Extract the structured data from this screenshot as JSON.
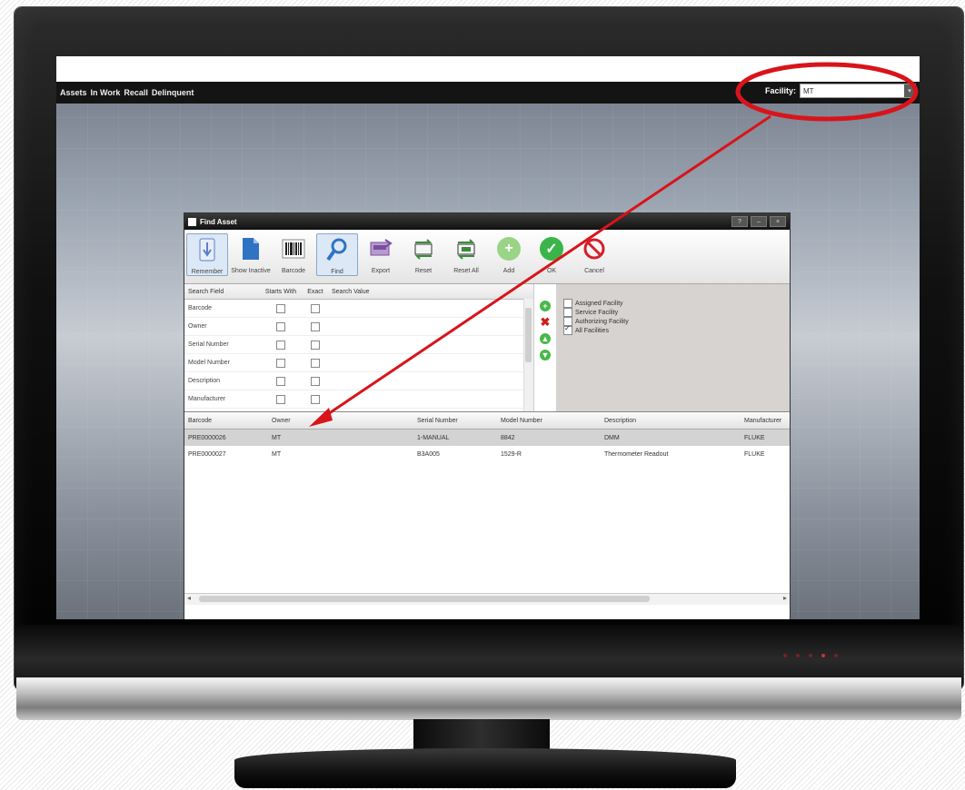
{
  "menubar": {
    "items": [
      "Assets",
      "In Work",
      "Recall",
      "Delinquent"
    ]
  },
  "facility": {
    "label": "Facility:",
    "value": "MT"
  },
  "dialog": {
    "title": "Find Asset",
    "window_buttons": [
      "?",
      "–",
      "×"
    ],
    "toolbar": [
      {
        "label": "Remember",
        "icon": "remember-icon",
        "color": "#5a7fd1"
      },
      {
        "label": "Show Inactive",
        "icon": "document-icon",
        "color": "#2f74c2"
      },
      {
        "label": "Barcode",
        "icon": "barcode-icon",
        "color": "#333333"
      },
      {
        "label": "Find",
        "icon": "magnifier-icon",
        "color": "#2f74c2"
      },
      {
        "label": "Export",
        "icon": "export-icon",
        "color": "#7a4fa0"
      },
      {
        "label": "Reset",
        "icon": "reset-icon",
        "color": "#3a8a3a"
      },
      {
        "label": "Reset All",
        "icon": "reset-all-icon",
        "color": "#3a8a3a"
      },
      {
        "label": "Add",
        "icon": "add-icon",
        "color": "#8fd17a"
      },
      {
        "label": "OK",
        "icon": "ok-icon",
        "color": "#3bb54a"
      },
      {
        "label": "Cancel",
        "icon": "cancel-icon",
        "color": "#d71e2b"
      }
    ],
    "search": {
      "headers": {
        "field": "Search Field",
        "starts": "Starts With",
        "exact": "Exact",
        "value": "Search Value"
      },
      "rows": [
        "Barcode",
        "Owner",
        "Serial Number",
        "Model Number",
        "Description",
        "Manufacturer"
      ]
    },
    "filters": [
      {
        "label": "Assigned Facility",
        "checked": false
      },
      {
        "label": "Service Facility",
        "checked": false
      },
      {
        "label": "Authorizing Facility",
        "checked": false
      },
      {
        "label": "All Facilities",
        "checked": true
      }
    ],
    "results": {
      "headers": {
        "barcode": "Barcode",
        "owner": "Owner",
        "serial": "Serial Number",
        "model": "Model Number",
        "desc": "Description",
        "mfr": "Manufacturer"
      },
      "rows": [
        {
          "barcode": "PRE0000026",
          "owner": "MT",
          "serial": "1-MANUAL",
          "model": "8842",
          "desc": "DMM",
          "mfr": "FLUKE"
        },
        {
          "barcode": "PRE0000027",
          "owner": "MT",
          "serial": "B3A005",
          "model": "1529-R",
          "desc": "Thermometer Readout",
          "mfr": "FLUKE"
        }
      ]
    }
  }
}
